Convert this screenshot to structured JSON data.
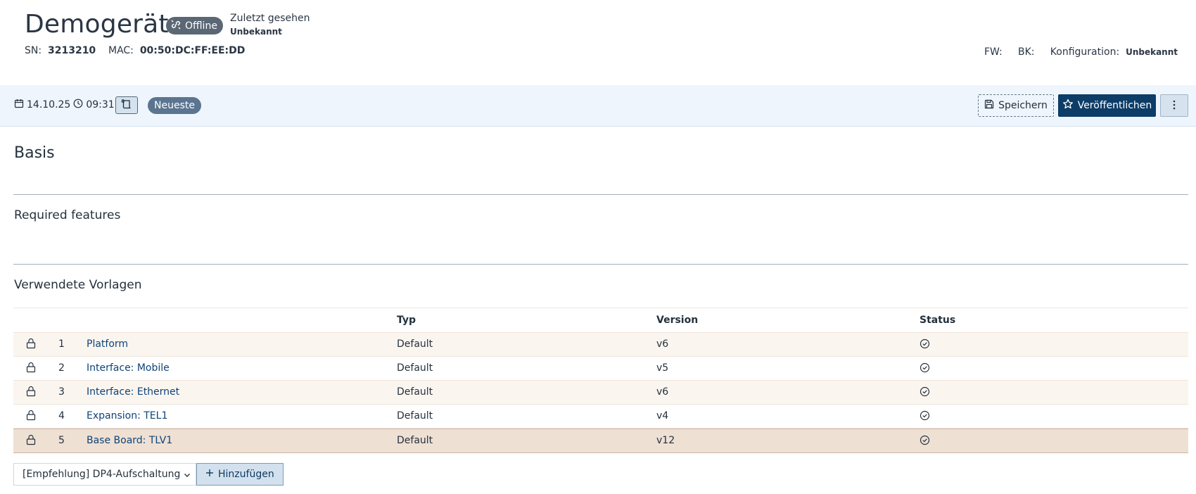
{
  "device": {
    "title": "Demogerät",
    "status_label": "Offline",
    "last_seen_label": "Zuletzt gesehen",
    "last_seen_value": "Unbekannt",
    "sn_label": "SN:",
    "sn_value": "3213210",
    "mac_label": "MAC:",
    "mac_value": "00:50:DC:FF:EE:DD",
    "fw_label": "FW:",
    "bk_label": "BK:",
    "config_label": "Konfiguration:",
    "config_value": "Unbekannt"
  },
  "toolbar": {
    "date": "14.10.25",
    "time": "09:31",
    "version_badge": "Neueste",
    "save_label": "Speichern",
    "publish_label": "Veröffentlichen",
    "icons": [
      "calendar-icon",
      "clock-icon",
      "scroll-icon",
      "save-icon",
      "star-icon",
      "more-vertical-icon"
    ]
  },
  "sections": {
    "basis": "Basis",
    "required_features": "Required features",
    "templates": "Verwendete Vorlagen"
  },
  "table": {
    "headers": {
      "typ": "Typ",
      "version": "Version",
      "status": "Status"
    },
    "rows": [
      {
        "index": "1",
        "name": "Platform",
        "typ": "Default",
        "version": "v6"
      },
      {
        "index": "2",
        "name": "Interface: Mobile",
        "typ": "Default",
        "version": "v5"
      },
      {
        "index": "3",
        "name": "Interface: Ethernet",
        "typ": "Default",
        "version": "v6"
      },
      {
        "index": "4",
        "name": "Expansion: TEL1",
        "typ": "Default",
        "version": "v4"
      },
      {
        "index": "5",
        "name": "Base Board: TLV1",
        "typ": "Default",
        "version": "v12"
      }
    ]
  },
  "add": {
    "selected_option": "[Empfehlung] DP4-Aufschaltung",
    "button_label": "Hinzufügen"
  }
}
